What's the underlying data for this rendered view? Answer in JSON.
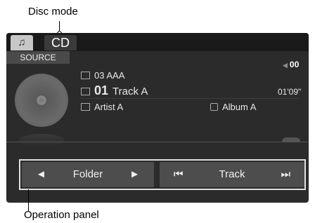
{
  "callouts": {
    "top": "Disc mode",
    "bottom": "Operation panel"
  },
  "tabs": {
    "music_icon": "♫",
    "cd_label": "CD"
  },
  "source_label": "SOURCE",
  "track": {
    "folder": "03  AAA",
    "number": "01",
    "title": "Track A",
    "artist": "Artist A",
    "album": "Album A",
    "time": "01'09\"",
    "volume": "00"
  },
  "panel": {
    "prev_folder": "◄",
    "folder_label": "Folder",
    "next_folder": "►",
    "prev_track": "⏮",
    "track_label": "Track",
    "next_track": "⏭"
  }
}
